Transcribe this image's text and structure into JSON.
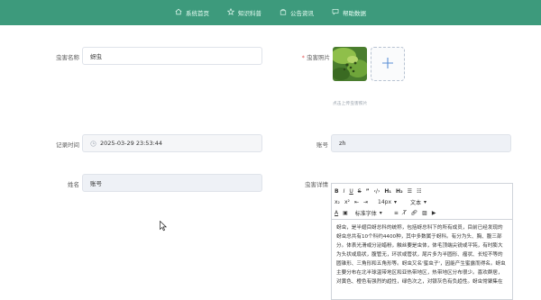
{
  "nav": {
    "items": [
      {
        "label": "系统首页",
        "icon": "home-icon"
      },
      {
        "label": "知识科普",
        "icon": "star-icon"
      },
      {
        "label": "公告资讯",
        "icon": "bag-icon"
      },
      {
        "label": "帮助数据",
        "icon": "chat-icon"
      }
    ]
  },
  "form": {
    "name_label": "虫害名称",
    "name_value": "蚜虫",
    "photo_label": "虫害照片",
    "photo_required_mark": "*",
    "photo_hint": "点击上传虫害照片",
    "time_label": "记录时间",
    "time_value": "2025-03-29 23:53:44",
    "account_label": "账号",
    "account_value": "zh",
    "surname_label": "姓名",
    "surname_value": "账号",
    "detail_label": "虫害详情"
  },
  "editor": {
    "size_value": "14px",
    "type_value": "文本",
    "font_value": "标准字体",
    "content": "蚜虫，是半翅目蚜总科的统称，包括蚜总科下的所有成员，目前已经发现的蚜虫总共有10个科约4400种，其中多数属于蚜科。有分为头、胸、腹三部分。体表光滑或分泌蜡粉，触丝要是虫体，体毛顶端尖锐或平钝，有时膨大为头状或扇状，腹管无，环状或管状，尾片多为半圆形、瘤状、长短不等的圆锥形、三角形和五角形等。蚜虫又名'蜜虫子'，因能产生蜜露而得名。蚜虫主要分布在北半球温带地区和亚热带地区，热带地区分布很少。喜欢群居，对黄色、橙色有强烈的趋性，绿色次之，对银灰色有负趋性。蚜虫常聚集在"
  },
  "colors": {
    "nav_bg": "#3d9a7c",
    "required": "#e25555"
  }
}
